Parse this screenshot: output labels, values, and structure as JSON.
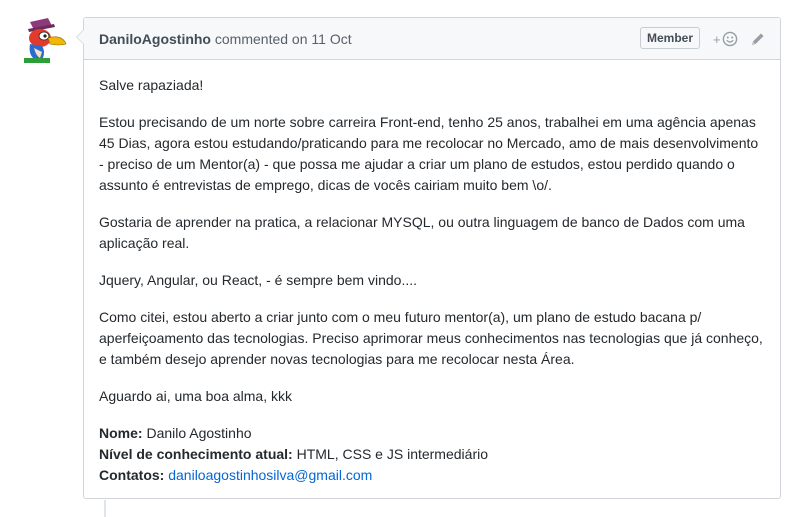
{
  "comment": {
    "author": "DaniloAgostinho",
    "action": "commented on",
    "date": "11 Oct",
    "badge": "Member",
    "reaction_plus": "+",
    "paragraphs": [
      "Salve rapaziada!",
      "Estou precisando de um norte sobre carreira Front-end, tenho 25 anos, trabalhei em uma agência apenas 45 Dias, agora estou estudando/praticando para me recolocar no Mercado, amo de mais desenvolvimento - preciso de um Mentor(a) - que possa me ajudar a criar um plano de estudos, estou perdido quando o assunto é entrevistas de emprego, dicas de vocês cairiam muito bem \\o/.",
      "Gostaria de aprender na pratica, a relacionar MYSQL, ou outra linguagem de banco de Dados com uma aplicação real.",
      "Jquery, Angular, ou React, - é sempre bem vindo....",
      "Como citei, estou aberto a criar junto com o meu futuro mentor(a), um plano de estudo bacana p/ aperfeiçoamento das tecnologias. Preciso aprimorar meus conhecimentos nas tecnologias que já conheço, e também desejo aprender novas tecnologias para me recolocar nesta Área.",
      "Aguardo ai, uma boa alma, kkk"
    ],
    "info": {
      "name_label": "Nome:",
      "name_value": " Danilo Agostinho",
      "level_label": "Nível de conhecimento atual:",
      "level_value": " HTML, CSS e JS intermediário",
      "contact_label": "Contatos:",
      "contact_value": "daniloagostinhosilva@gmail.com"
    }
  },
  "icons": {
    "avatar": "woodpecker-avatar",
    "reaction": "smiley-icon",
    "edit": "pencil-icon"
  },
  "colors": {
    "link": "#0366d6",
    "header_bg": "#f6f8fa",
    "border": "#d1d5da"
  }
}
